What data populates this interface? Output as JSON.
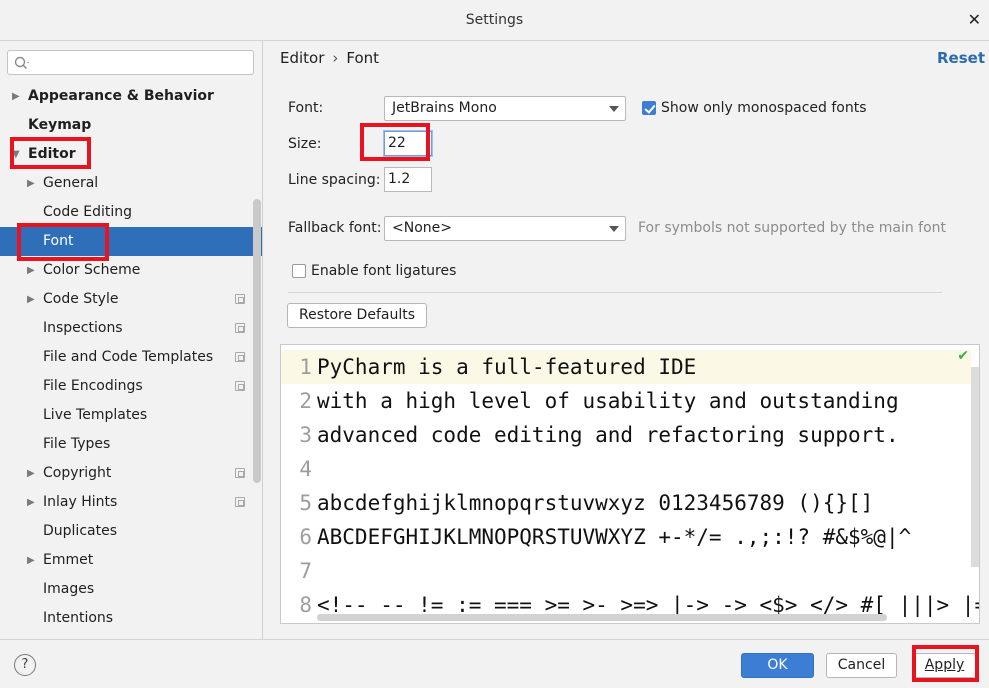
{
  "window": {
    "title": "Settings",
    "close_glyph": "✕"
  },
  "search": {
    "placeholder": "",
    "icon": "search-icon"
  },
  "sidebar": {
    "items": [
      {
        "label": "Appearance & Behavior",
        "expandable": true
      },
      {
        "label": "Keymap",
        "expandable": false
      },
      {
        "label": "Editor",
        "expandable": true,
        "expanded": true
      },
      {
        "label": "General",
        "expandable": true
      },
      {
        "label": "Code Editing",
        "expandable": false
      },
      {
        "label": "Font",
        "expandable": false,
        "selected": true
      },
      {
        "label": "Color Scheme",
        "expandable": true
      },
      {
        "label": "Code Style",
        "expandable": true
      },
      {
        "label": "Inspections",
        "expandable": false
      },
      {
        "label": "File and Code Templates",
        "expandable": false
      },
      {
        "label": "File Encodings",
        "expandable": false
      },
      {
        "label": "Live Templates",
        "expandable": false
      },
      {
        "label": "File Types",
        "expandable": false
      },
      {
        "label": "Copyright",
        "expandable": true
      },
      {
        "label": "Inlay Hints",
        "expandable": true
      },
      {
        "label": "Duplicates",
        "expandable": false
      },
      {
        "label": "Emmet",
        "expandable": true
      },
      {
        "label": "Images",
        "expandable": false
      },
      {
        "label": "Intentions",
        "expandable": false
      }
    ]
  },
  "header": {
    "crumb_parent": "Editor",
    "crumb_sep": "›",
    "crumb_current": "Font",
    "reset_label": "Reset"
  },
  "form": {
    "font_label": "Font:",
    "font_value": "JetBrains Mono",
    "mono_label": "Show only monospaced fonts",
    "mono_checked": true,
    "size_label": "Size:",
    "size_value": "22",
    "spacing_label": "Line spacing:",
    "spacing_value": "1.2",
    "fallback_label": "Fallback font:",
    "fallback_value": "<None>",
    "fallback_hint": "For symbols not supported by the main font",
    "ligatures_label": "Enable font ligatures",
    "ligatures_checked": false,
    "restore_label": "Restore Defaults"
  },
  "preview": {
    "lines": [
      {
        "num": "1",
        "text": "PyCharm is a full-featured IDE"
      },
      {
        "num": "2",
        "text": "with a high level of usability and outstanding"
      },
      {
        "num": "3",
        "text": "advanced code editing and refactoring support."
      },
      {
        "num": "4",
        "text": ""
      },
      {
        "num": "5",
        "text": "abcdefghijklmnopqrstuvwxyz 0123456789 (){}[]"
      },
      {
        "num": "6",
        "text": "ABCDEFGHIJKLMNOPQRSTUVWXYZ +-*/= .,;:!? #&$%@|^"
      },
      {
        "num": "7",
        "text": ""
      },
      {
        "num": "8",
        "text": "<!-- -- != := === >= >- >=> |-> -> <$> </> #[ |||> |= ~@"
      }
    ],
    "check_glyph": "✔"
  },
  "footer": {
    "help_label": "?",
    "ok_label": "OK",
    "cancel_label": "Cancel",
    "apply_label": "Apply"
  },
  "colors": {
    "accent": "#2f6fba",
    "highlight_box": "#e8131f",
    "ok_button": "#3c7ed4"
  }
}
